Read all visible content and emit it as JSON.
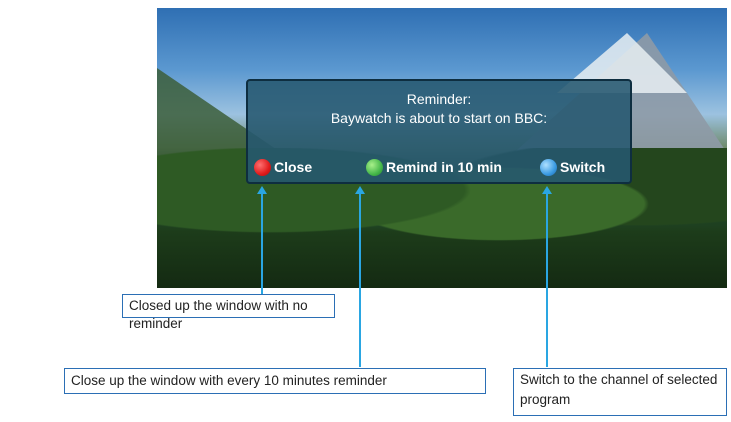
{
  "dialog": {
    "line1": "Reminder:",
    "line2": "Baywatch is about to start on BBC:",
    "options": [
      {
        "label": "Close",
        "color": "#e01b1b"
      },
      {
        "label": "Remind in 10 min",
        "color": "#45b74a"
      },
      {
        "label": "Switch",
        "color": "#3a9be3"
      }
    ]
  },
  "annotations": [
    {
      "text": "Closed up the window with no reminder"
    },
    {
      "text": "Close up the window with every 10 minutes reminder"
    },
    {
      "text": "Switch to the channel of selected program"
    }
  ],
  "colors": {
    "callout": "#2aa6e2",
    "dialog_bg": "#265870"
  }
}
